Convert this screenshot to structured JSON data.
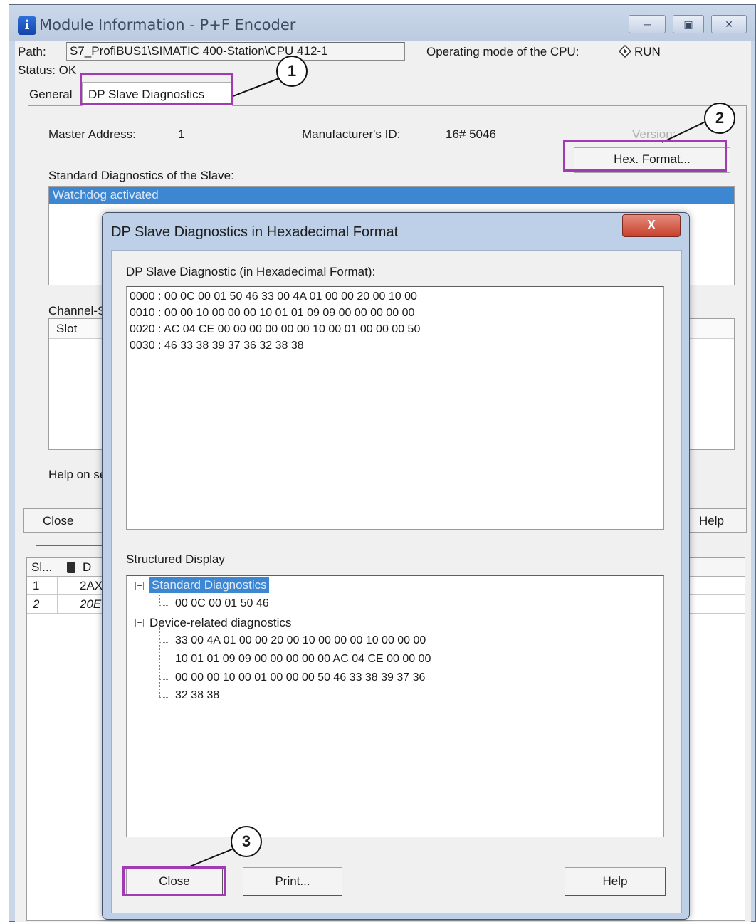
{
  "main_window": {
    "title": "Module Information - P+F Encoder",
    "path_label": "Path:",
    "path_value": "S7_ProfiBUS1\\SIMATIC 400-Station\\CPU 412-1",
    "opmode_label": "Operating mode of the  CPU:",
    "opmode_value": "RUN",
    "status_label": "Status: OK",
    "tabs": [
      {
        "label": "General"
      },
      {
        "label": "DP Slave Diagnostics"
      }
    ],
    "master_address_label": "Master Address:",
    "master_address_value": "1",
    "manufacturer_label": "Manufacturer's ID:",
    "manufacturer_value": "16# 5046",
    "version_label": "Version:",
    "hex_format_button": "Hex. Format...",
    "std_diag_label": "Standard Diagnostics of the Slave:",
    "std_diag_items": [
      "Watchdog activated"
    ],
    "channel_label_partial": "Channel-S",
    "slot_column": "Slot",
    "help_on_partial": "Help on se",
    "close_button": "Close",
    "help_button": "Help"
  },
  "bottom_table": {
    "header_col1": "Sl...",
    "header_col2": "D",
    "rows": [
      {
        "slot": "1",
        "value": "2AX"
      },
      {
        "slot": "2",
        "value": "20E"
      }
    ]
  },
  "dialog": {
    "title": "DP Slave Diagnostics in Hexadecimal Format",
    "close_glyph": "X",
    "hex_label": "DP Slave Diagnostic (in Hexadecimal Format):",
    "hex_lines": [
      "0000 :  00 0C 00 01 50 46 33 00 4A 01 00 00 20 00 10 00",
      "0010 :  00 00 10 00 00 00 10 01 01 09 09 00 00 00 00 00",
      "0020 :  AC 04 CE 00 00 00 00 00 00 10 00 01 00 00 00 50",
      "0030 :  46 33 38 39 37 36 32 38 38"
    ],
    "structured_label": "Structured Display",
    "tree": {
      "std_node": "Standard Diagnostics",
      "std_leaf": "00 0C 00 01 50 46",
      "dev_node": "Device-related diagnostics",
      "dev_leaves": [
        "33 00 4A 01 00 00 20 00 10 00 00 00 10 00 00 00",
        "10 01 01 09 09 00 00 00 00 00 AC 04 CE 00 00 00",
        "00 00 00 10 00 01 00 00 00 50 46 33 38 39 37 36",
        "32 38 38"
      ]
    },
    "buttons": {
      "close": "Close",
      "print": "Print...",
      "help": "Help"
    }
  },
  "callouts": [
    "1",
    "2",
    "3"
  ],
  "colors": {
    "highlight": "#a23ab6",
    "selection": "#3d86d1",
    "titlebar": "#c9d6e8"
  }
}
